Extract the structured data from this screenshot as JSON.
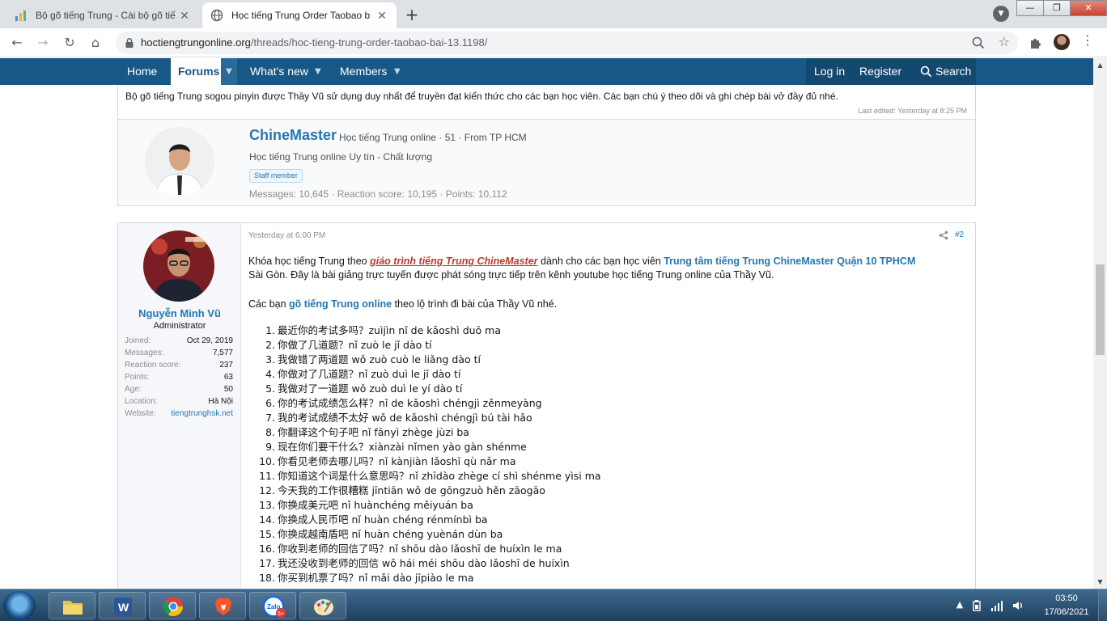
{
  "browser": {
    "tabs": [
      {
        "title": "Bộ gõ tiếng Trung - Cài bộ gõ tiế",
        "active": false
      },
      {
        "title": "Học tiếng Trung Order Taobao b",
        "active": true
      }
    ],
    "url_host": "hoctiengtrungonline.org",
    "url_path": "/threads/hoc-tieng-trung-order-taobao-bai-13.1198/"
  },
  "site_nav": {
    "home": "Home",
    "forums": "Forums",
    "whats_new": "What's new",
    "members": "Members",
    "login": "Log in",
    "register": "Register",
    "search": "Search"
  },
  "prev_post": {
    "text": "Bộ gõ tiếng Trung sogou pinyin được Thầy Vũ sử dụng duy nhất để truyền đạt kiến thức cho các bạn học viên. Các bạn chú ý theo dõi và ghi chép bài vở đầy đủ nhé.",
    "edited": "Last edited: Yesterday at 8:25 PM"
  },
  "signature": {
    "name": "ChineMaster",
    "meta": "Học tiếng Trung online · 51 · From TP HCM",
    "about": "Học tiếng Trung online Uy tín - Chất lượng",
    "badge": "Staff member",
    "stats": "Messages: 10,645 · Reaction score: 10,195 · Points: 10,112"
  },
  "post": {
    "date": "Yesterday at 6:00 PM",
    "number": "#2",
    "user": {
      "name": "Nguyễn Minh Vũ",
      "title": "Administrator",
      "extra": [
        {
          "k": "Joined:",
          "v": "Oct 29, 2019"
        },
        {
          "k": "Messages:",
          "v": "7,577"
        },
        {
          "k": "Reaction score:",
          "v": "237"
        },
        {
          "k": "Points:",
          "v": "63"
        },
        {
          "k": "Age:",
          "v": "50"
        },
        {
          "k": "Location:",
          "v": "Hà Nội"
        },
        {
          "k": "Website:",
          "v": "tiengtrunghsk.net"
        }
      ]
    },
    "intro1_a": "Khóa học tiếng Trung theo ",
    "intro1_link": "giáo trình tiếng Trung ChineMaster",
    "intro1_b": " dành cho các bạn học viên ",
    "intro1_link2": "Trung tâm tiếng Trung ChineMaster Quận 10 TPHCM",
    "intro2": "Sài Gòn. Đây là bài giảng trực tuyến được phát sóng trực tiếp trên kênh youtube học tiếng Trung online của Thầy Vũ.",
    "intro3_a": "Các bạn ",
    "intro3_link": "gõ tiếng Trung online",
    "intro3_b": " theo lộ trình đi bài của Thầy Vũ nhé.",
    "phrases": [
      "最近你的考试多吗？zuìjìn nǐ de kǎoshì duō ma",
      "你做了几道题？nǐ zuò le jǐ dào tí",
      "我做错了两道题 wǒ zuò cuò le liǎng dào tí",
      "你做对了几道题？nǐ zuò duì le jǐ dào tí",
      "我做对了一道题 wǒ zuò duì le yí dào tí",
      "你的考试成绩怎么样？nǐ de kǎoshì chéngjì zěnmeyàng",
      "我的考试成绩不太好 wǒ de kǎoshì chéngjì bú tài hǎo",
      "你翻译这个句子吧 nǐ fānyì zhège jùzi ba",
      "现在你们要干什么？xiànzài nǐmen yào gàn shénme",
      "你看见老师去哪儿吗？nǐ kànjiàn lǎoshī qù nǎr ma",
      "你知道这个词是什么意思吗？nǐ zhīdào zhège cí shì shénme yìsi ma",
      "今天我的工作很糟糕 jīntiān wǒ de gōngzuò hěn zāogāo",
      "你换成美元吧 nǐ huànchéng měiyuán ba",
      "你换成人民币吧 nǐ huàn chéng rénmínbì ba",
      "你换成越南盾吧 nǐ huàn chéng yuènán dùn ba",
      "你收到老师的回信了吗？nǐ shōu dào lǎoshī de huíxìn le ma",
      "我还没收到老师的回信 wǒ hái méi shōu dào lǎoshī de huíxìn",
      "你买到机票了吗？nǐ mǎi dào jīpiào le ma"
    ]
  },
  "taskbar": {
    "time": "03:50",
    "date": "17/06/2021"
  }
}
